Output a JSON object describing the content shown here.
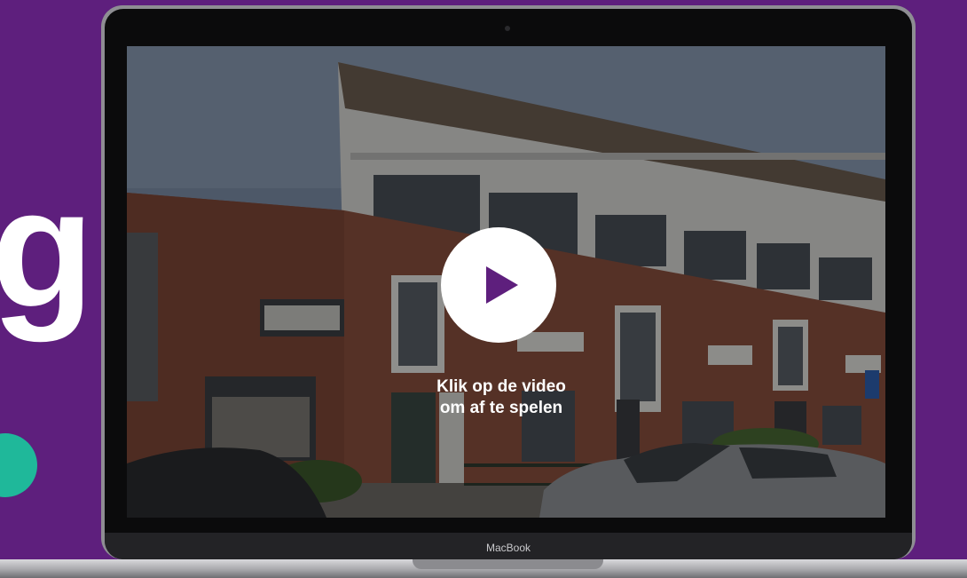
{
  "background": {
    "logo_letter": "g",
    "colors": {
      "background": "#5e1f7d",
      "accent_dot": "#1fb89a"
    }
  },
  "laptop": {
    "brand_label": "MacBook"
  },
  "video": {
    "caption_line1": "Klik op de video",
    "caption_line2": "om af te spelen",
    "play_icon": "play-icon",
    "thumbnail": "row-houses-street-scene",
    "colors": {
      "play_button": "#ffffff",
      "play_icon": "#5e1f7d"
    }
  }
}
